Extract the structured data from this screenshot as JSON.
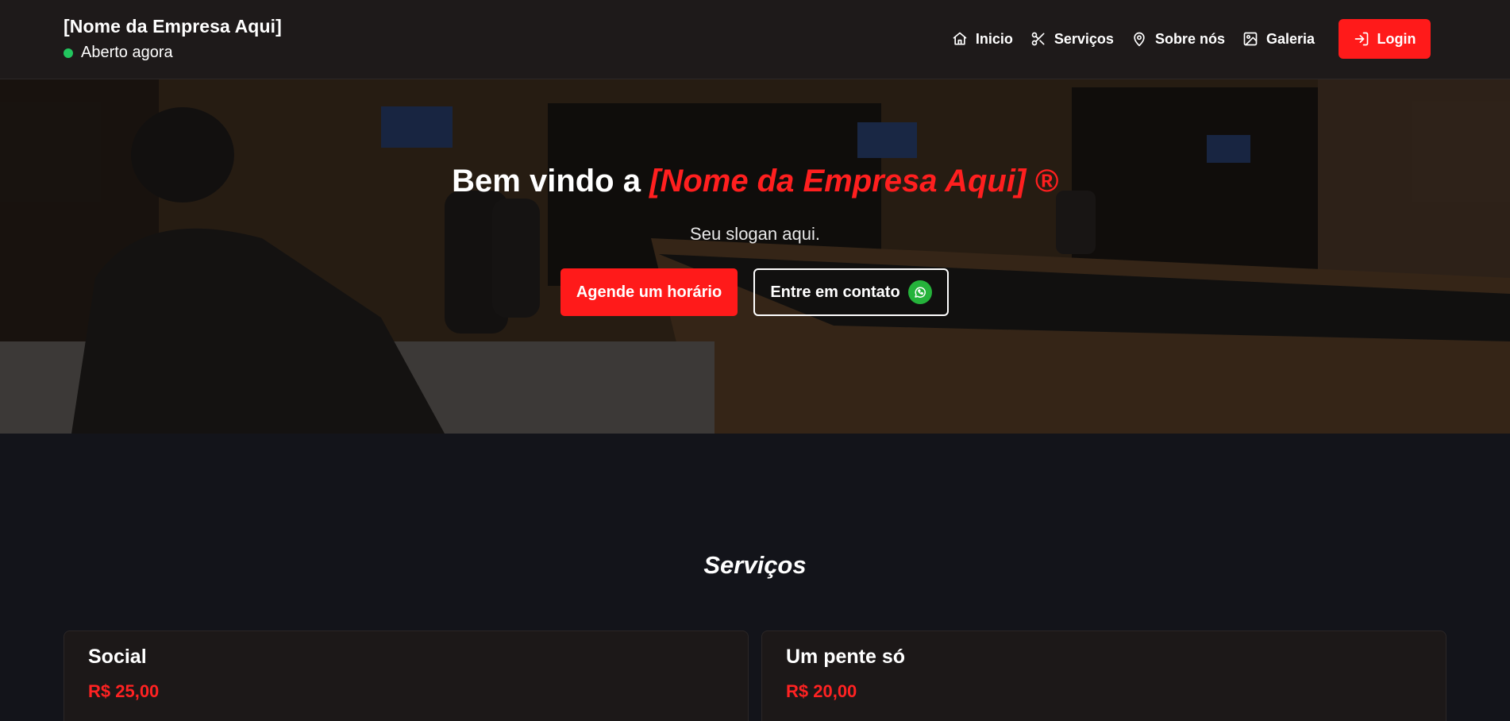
{
  "header": {
    "brand": "[Nome da Empresa Aqui]",
    "status": "Aberto agora",
    "status_color": "#22c55e",
    "nav": [
      {
        "label": "Inicio",
        "icon": "home-icon"
      },
      {
        "label": "Serviços",
        "icon": "scissors-icon"
      },
      {
        "label": "Sobre nós",
        "icon": "map-pin-icon"
      },
      {
        "label": "Galeria",
        "icon": "image-icon"
      }
    ],
    "login": {
      "label": "Login",
      "icon": "login-icon"
    }
  },
  "hero": {
    "title_prefix": "Bem vindo a",
    "title_accent": "[Nome da Empresa Aqui] ®",
    "slogan": "Seu slogan aqui.",
    "primary_button": "Agende um horário",
    "secondary_button": "Entre em contato",
    "secondary_icon": "whatsapp-icon"
  },
  "services": {
    "title": "Serviços",
    "items": [
      {
        "name": "Social",
        "price": "R$ 25,00"
      },
      {
        "name": "Um pente só",
        "price": "R$ 20,00"
      }
    ]
  },
  "colors": {
    "accent": "#ff1a1a",
    "header_bg": "#1e1a1a",
    "page_bg": "#13141a",
    "card_bg": "#1c1818"
  }
}
